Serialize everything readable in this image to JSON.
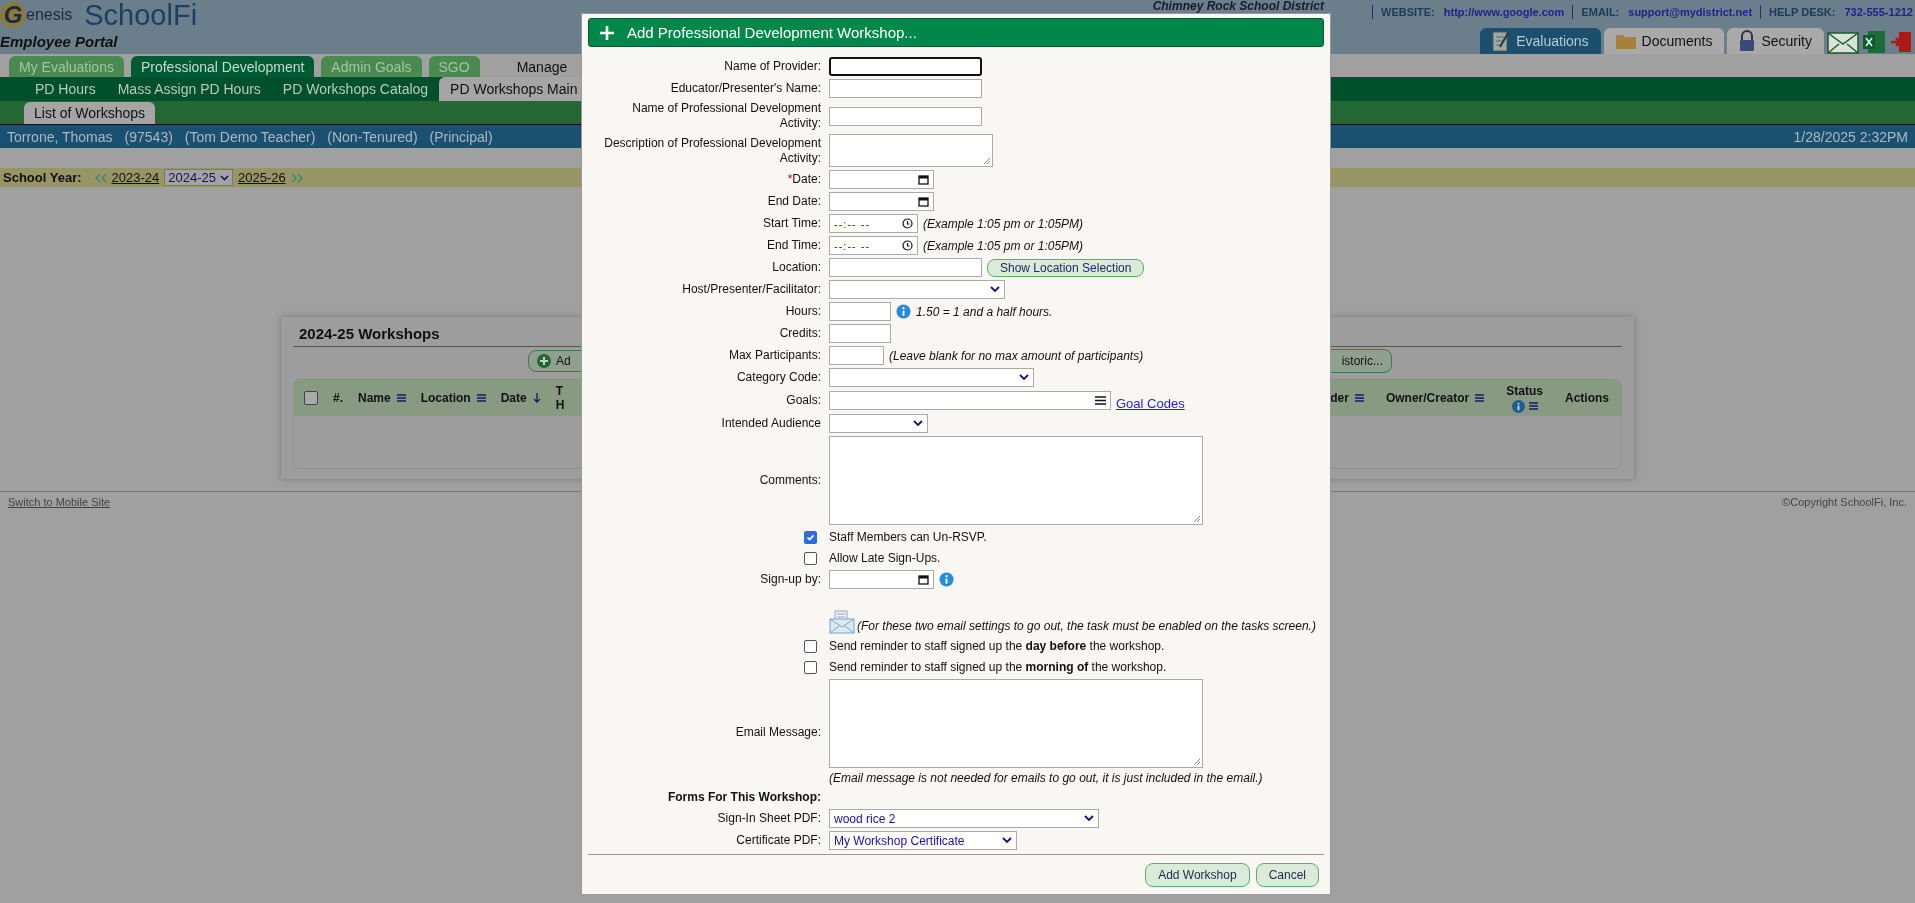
{
  "header": {
    "logo_initial": "G",
    "logo_text": "enesis",
    "app_name": "SchoolFi",
    "portal": "Employee Portal",
    "district": "Chimney Rock School District",
    "contacts": [
      {
        "label": "WEBSITE:",
        "value": "http://www.google.com"
      },
      {
        "label": "EMAIL:",
        "value": "support@mydistrict.net"
      },
      {
        "label": "HELP DESK:",
        "value": "732-555-1212"
      }
    ],
    "module_tabs": [
      {
        "label": "Evaluations",
        "kind": "notepad",
        "selected": true
      },
      {
        "label": "Documents",
        "kind": "folder",
        "selected": false
      },
      {
        "label": "Security",
        "kind": "lock",
        "selected": false
      }
    ]
  },
  "main_tabs": [
    {
      "label": "My Evaluations",
      "kind": "tab",
      "selected": false
    },
    {
      "label": "Professional Development",
      "kind": "tab",
      "selected": true
    },
    {
      "label": "Admin Goals",
      "kind": "tab",
      "selected": false
    },
    {
      "label": "SGO",
      "kind": "tab",
      "selected": false
    },
    {
      "label": "Manage",
      "kind": "link",
      "selected": false
    }
  ],
  "sub_tabs": [
    {
      "label": "PD Hours",
      "selected": false
    },
    {
      "label": "Mass Assign PD Hours",
      "selected": false
    },
    {
      "label": "PD Workshops Catalog",
      "selected": false
    },
    {
      "label": "PD Workshops Main",
      "selected": true
    }
  ],
  "third_tabs": [
    {
      "label": "List of Workshops",
      "selected": true
    }
  ],
  "user_bar": {
    "name": "Torrone, Thomas",
    "details": [
      "(97543)",
      "(Tom Demo Teacher)",
      "(Non-Tenured)",
      "(Principal)"
    ],
    "datetime": "1/28/2025 2:32PM"
  },
  "school_year": {
    "label": "School Year:",
    "previous": "2023-24",
    "current": "2024-25",
    "next": "2025-26"
  },
  "workshops_panel": {
    "title": "2024-25 Workshops",
    "select_all_checked": false,
    "add_button": "Ad",
    "historic_button": "istoric...",
    "left_columns": [
      {
        "label": "#.",
        "kind": "plain"
      },
      {
        "label": "Name",
        "kind": "menu"
      },
      {
        "label": "Location",
        "kind": "menu"
      },
      {
        "label": "Date",
        "kind": "sort"
      },
      {
        "label": "T H",
        "kind": "plain"
      }
    ],
    "right_columns": [
      {
        "label": "der",
        "kind": "menu"
      },
      {
        "label": "Owner/Creator",
        "kind": "menu"
      },
      {
        "label": "Status",
        "kind": "status"
      },
      {
        "label": "Actions",
        "kind": "plain"
      }
    ]
  },
  "footer": {
    "mobile_link": "Switch to Mobile Site",
    "copyright": "©Copyright SchoolFi, Inc."
  },
  "dialog": {
    "title": "Add Professional Development Workshop...",
    "rows": [
      {
        "kind": "text",
        "label": "Name of Provider:",
        "focused": true
      },
      {
        "kind": "text",
        "label": "Educator/Presenter's Name:",
        "focused": false
      },
      {
        "kind": "text",
        "label": "Name of Professional Development Activity:",
        "focused": false
      },
      {
        "kind": "textarea",
        "label": "Description of Professional Development Activity:"
      },
      {
        "kind": "date",
        "label": "Date:",
        "required_mark": "*"
      },
      {
        "kind": "date",
        "label": "End Date:"
      },
      {
        "kind": "time",
        "label": "Start Time:",
        "placeholder": "--:-- --",
        "hint": "(Example 1:05 pm or 1:05PM)"
      },
      {
        "kind": "time",
        "label": "End Time:",
        "placeholder": "--:-- --",
        "hint": "(Example 1:05 pm or 1:05PM)"
      },
      {
        "kind": "text",
        "label": "Location:",
        "focused": false,
        "button": "Show Location Selection"
      },
      {
        "kind": "select",
        "label": "Host/Presenter/Facilitator:"
      },
      {
        "kind": "text",
        "label": "Hours:",
        "focused": false,
        "info": true,
        "hint": "1.50 = 1 and a half hours."
      },
      {
        "kind": "text",
        "label": "Credits:",
        "focused": false
      },
      {
        "kind": "text",
        "label": "Max Participants:",
        "focused": false,
        "hint": "(Leave blank for no max amount of participants)"
      },
      {
        "kind": "select",
        "label": "Category Code:"
      },
      {
        "kind": "goals",
        "label": "Goals:",
        "link": "Goal Codes"
      },
      {
        "kind": "select",
        "label": "Intended Audience"
      },
      {
        "kind": "textarea",
        "label": "Comments:"
      },
      {
        "kind": "checkbox",
        "text": "Staff Members can Un-RSVP.",
        "checked": true
      },
      {
        "kind": "checkbox",
        "text": "Allow Late Sign-Ups.",
        "checked": false
      },
      {
        "kind": "date",
        "label": "Sign-up by:",
        "info": true
      },
      {
        "kind": "note",
        "text": "(For these two email settings to go out, the task must be enabled on the tasks screen.)"
      },
      {
        "kind": "checkbox",
        "text": "Send reminder to staff signed up the **day before** the workshop.",
        "checked": false
      },
      {
        "kind": "checkbox",
        "text": "Send reminder to staff signed up the **morning of** the workshop.",
        "checked": false
      },
      {
        "kind": "textarea",
        "label": "Email Message:",
        "hint": "(Email message is not needed for emails to go out, it is just included in the email.)"
      },
      {
        "kind": "heading",
        "label": "Forms For This Workshop:"
      },
      {
        "kind": "select",
        "label": "Sign-In Sheet PDF:",
        "value": "wood rice 2"
      },
      {
        "kind": "select",
        "label": "Certificate PDF:",
        "value": "My Workshop Certificate"
      }
    ],
    "buttons": [
      "Add Workshop",
      "Cancel"
    ]
  }
}
